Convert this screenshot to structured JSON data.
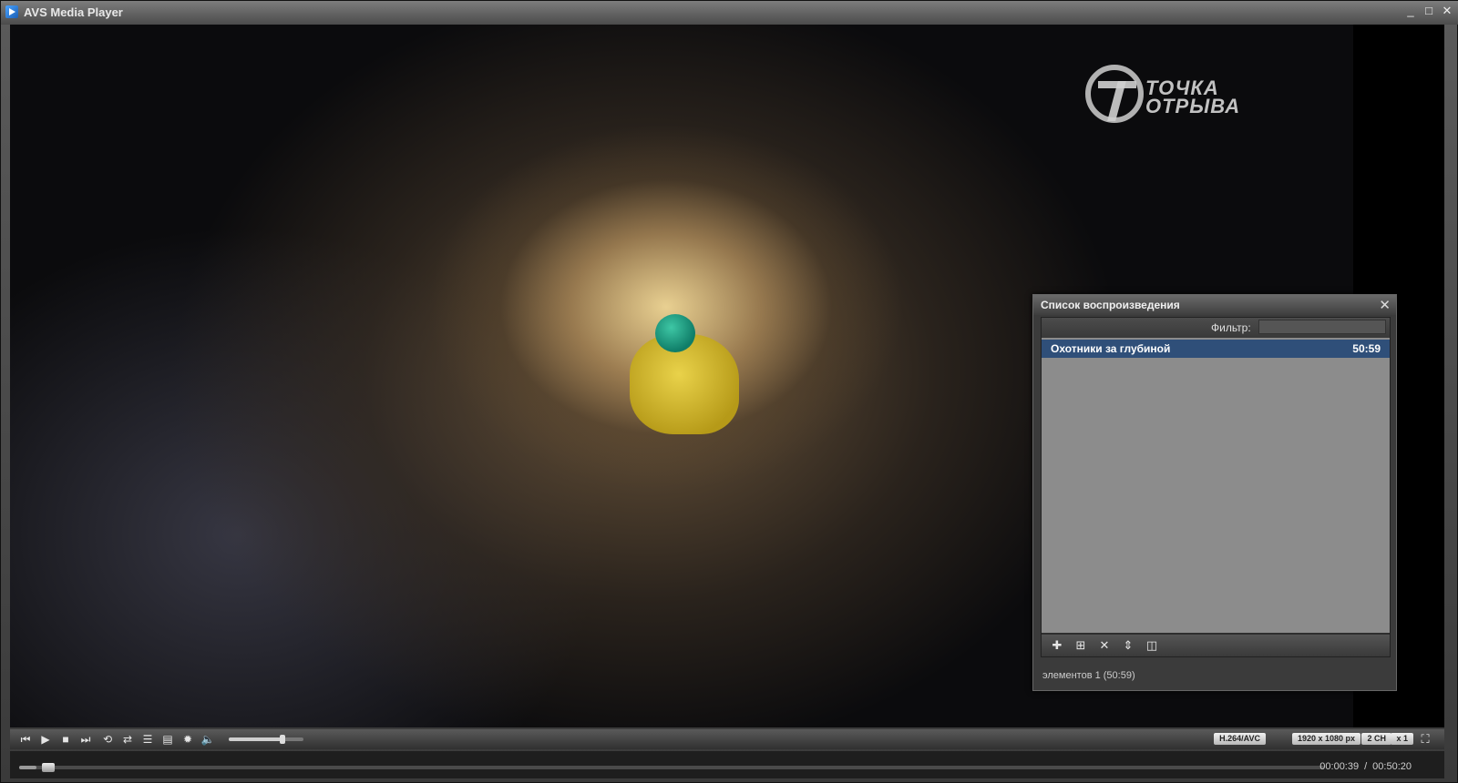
{
  "window": {
    "title": "AVS Media Player",
    "controls": [
      "minimize",
      "maximize",
      "close"
    ]
  },
  "video": {
    "logo_text_line1": "ТОЧКА",
    "logo_text_line2": "ОТРЫВА"
  },
  "playlist": {
    "title": "Список воспроизведения",
    "filter_label": "Фильтр:",
    "filter_value": "",
    "items": [
      {
        "title": "Охотники за глубиной",
        "duration": "50:59",
        "selected": true
      }
    ],
    "toolbar_icons": [
      "add-icon",
      "add-folder-icon",
      "remove-icon",
      "sort-icon",
      "view-toggle-icon"
    ],
    "count_text": "элементов 1 (50:59)"
  },
  "player": {
    "buttons": [
      "previous-icon",
      "play-icon",
      "stop-icon",
      "next-icon",
      "repeat-icon",
      "shuffle-icon",
      "playlist-toggle-icon",
      "settings-icon",
      "effects-icon",
      "volume-icon"
    ],
    "volume_level": 0.72,
    "badges": {
      "codec": "H.264/AVC",
      "resolution": "1920 x 1080 px",
      "channels": "2 CH",
      "speed": "x 1"
    },
    "progress_fraction": 0.013,
    "time_current": "00:00:39",
    "time_total": "00:50:20"
  },
  "colors": {
    "selection": "#2f4f79",
    "list_background": "#8c8c8c"
  }
}
